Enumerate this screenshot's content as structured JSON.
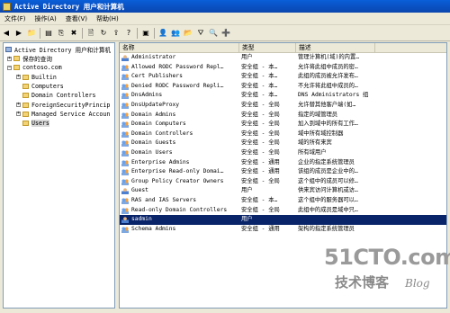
{
  "window": {
    "title": "Active Directory 用户和计算机"
  },
  "menu": [
    "文件(F)",
    "操作(A)",
    "查看(V)",
    "帮助(H)"
  ],
  "toolbar": {
    "icons": [
      "back-arrow-icon",
      "forward-arrow-icon",
      "up-folder-icon",
      "show-tree-icon",
      "copy-icon",
      "delete-icon",
      "properties-icon",
      "refresh-icon",
      "export-icon",
      "help-icon",
      "console-icon",
      "new-user-icon",
      "new-group-icon",
      "new-ou-icon",
      "filter-icon",
      "find-icon",
      "add-to-group-icon"
    ],
    "glyphs": [
      "◀",
      "▶",
      "📁",
      "▤",
      "⎘",
      "✖",
      "🗎",
      "↻",
      "⇪",
      "?",
      "▣",
      "👤",
      "👥",
      "📂",
      "⛛",
      "🔍",
      "➕"
    ]
  },
  "tree": {
    "root": "Active Directory 用户和计算机",
    "items": [
      {
        "label": "保存的查询",
        "indent": 1,
        "expander": "+"
      },
      {
        "label": "contoso.com",
        "indent": 1,
        "expander": "−"
      },
      {
        "label": "Builtin",
        "indent": 2,
        "expander": "+"
      },
      {
        "label": "Computers",
        "indent": 2,
        "expander": ""
      },
      {
        "label": "Domain Controllers",
        "indent": 2,
        "expander": ""
      },
      {
        "label": "ForeignSecurityPrincip",
        "indent": 2,
        "expander": "+"
      },
      {
        "label": "Managed Service Accoun",
        "indent": 2,
        "expander": "+"
      },
      {
        "label": "Users",
        "indent": 2,
        "expander": "",
        "selected": true
      }
    ]
  },
  "list": {
    "headers": {
      "name": "名称",
      "type": "类型",
      "desc": "描述"
    },
    "rows": [
      {
        "name": "Administrator",
        "type": "用户",
        "desc": "管理计算机(域)的内置…",
        "icon": "user"
      },
      {
        "name": "Allowed RODC Password Repl…",
        "type": "安全组 - 本…",
        "desc": "允许将此组中成员的密…",
        "icon": "group"
      },
      {
        "name": "Cert Publishers",
        "type": "安全组 - 本…",
        "desc": "此组的成员被允许发布…",
        "icon": "group"
      },
      {
        "name": "Denied RODC Password Repli…",
        "type": "安全组 - 本…",
        "desc": "不允许将此组中成员的…",
        "icon": "group"
      },
      {
        "name": "DnsAdmins",
        "type": "安全组 - 本…",
        "desc": "DNS Administrators 组",
        "icon": "group"
      },
      {
        "name": "DnsUpdateProxy",
        "type": "安全组 - 全局",
        "desc": "允许替其他客户端(如…",
        "icon": "group"
      },
      {
        "name": "Domain Admins",
        "type": "安全组 - 全局",
        "desc": "指定的域管理员",
        "icon": "group"
      },
      {
        "name": "Domain Computers",
        "type": "安全组 - 全局",
        "desc": "加入到域中的所有工作…",
        "icon": "group"
      },
      {
        "name": "Domain Controllers",
        "type": "安全组 - 全局",
        "desc": "域中所有域控制器",
        "icon": "group"
      },
      {
        "name": "Domain Guests",
        "type": "安全组 - 全局",
        "desc": "域的所有来宾",
        "icon": "group"
      },
      {
        "name": "Domain Users",
        "type": "安全组 - 全局",
        "desc": "所有域用户",
        "icon": "group"
      },
      {
        "name": "Enterprise Admins",
        "type": "安全组 - 通用",
        "desc": "企业的指定系统管理员",
        "icon": "group"
      },
      {
        "name": "Enterprise Read-only Domai…",
        "type": "安全组 - 通用",
        "desc": "该组的成员是企业中的…",
        "icon": "group"
      },
      {
        "name": "Group Policy Creator Owners",
        "type": "安全组 - 全局",
        "desc": "这个组中的成员可以修…",
        "icon": "group"
      },
      {
        "name": "Guest",
        "type": "用户",
        "desc": "供来宾访问计算机或访…",
        "icon": "user"
      },
      {
        "name": "RAS and IAS Servers",
        "type": "安全组 - 本…",
        "desc": "这个组中的服务器可以…",
        "icon": "group"
      },
      {
        "name": "Read-only Domain Controllers",
        "type": "安全组 - 全局",
        "desc": "此组中的成员是域中只…",
        "icon": "group"
      },
      {
        "name": "sadmin",
        "type": "用户",
        "desc": "",
        "icon": "user",
        "selected": true
      },
      {
        "name": "Schema Admins",
        "type": "安全组 - 通用",
        "desc": "架构的指定系统管理员",
        "icon": "group"
      }
    ]
  },
  "watermark": {
    "brand": "51CTO.com",
    "sub": "技术博客",
    "blog": "Blog"
  }
}
